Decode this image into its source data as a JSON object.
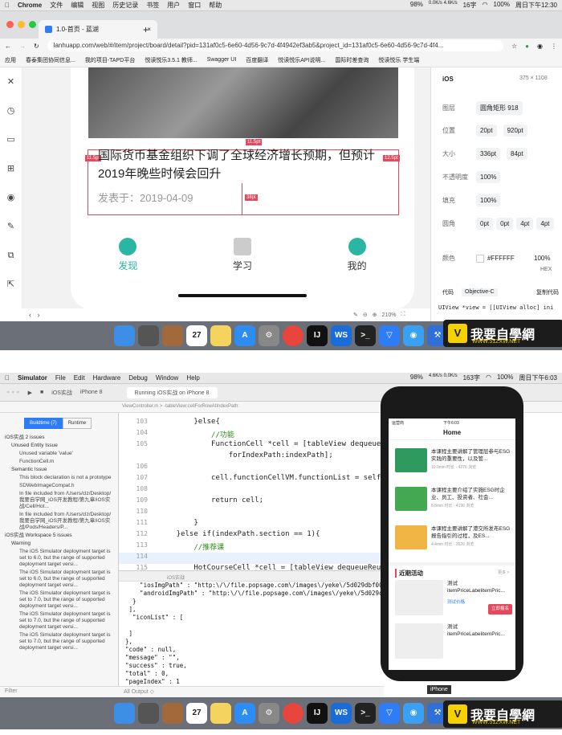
{
  "top": {
    "menubar": {
      "app": "Chrome",
      "menus": [
        "文件",
        "编辑",
        "视图",
        "历史记录",
        "书签",
        "用户",
        "窗口",
        "帮助"
      ],
      "status": [
        "98%",
        "0.0K/s 4.6K/s",
        "16字",
        "100%",
        "周日下午12:30"
      ]
    },
    "tab": {
      "title": "1.0-首页 - 蓝湖",
      "close": "×",
      "new": "+"
    },
    "url": "lanhuapp.com/web/#/item/project/board/detail?pid=131af0c5-6e60-4d56-9c7d-4f4942ef3ab5&project_id=131af0c5-6e60-4d56-9c7d-4f4...",
    "bookmarks": [
      "应用",
      "春泰集团协同信息...",
      "我的项目-TAPD平台",
      "悦读悦乐3.5.1 教师...",
      "Swagger UI",
      "百度翻译",
      "悦读悦乐API说明...",
      "国际时差查询",
      "悦读悦乐 学生端"
    ],
    "design": {
      "headline": "国际货币基金组织下调了全球经济增长预期，但预计2019年晚些时候会回升",
      "date": "发表于：2019-04-09",
      "tags": [
        "11.5pt",
        "11.5pt",
        "12.5pt",
        "38pt"
      ],
      "tabs": [
        "发现",
        "学习",
        "我的"
      ]
    },
    "zoom": "210%",
    "props": {
      "platform": "iOS",
      "size": "375 × 1108",
      "rows": [
        {
          "k": "图层",
          "v": [
            "圆角矩形 918"
          ]
        },
        {
          "k": "位置",
          "v": [
            "20pt",
            "920pt"
          ]
        },
        {
          "k": "大小",
          "v": [
            "336pt",
            "84pt"
          ]
        },
        {
          "k": "不透明度",
          "v": [
            "100%"
          ]
        },
        {
          "k": "填充",
          "v": [
            "100%"
          ]
        },
        {
          "k": "圆角",
          "v": [
            "0pt",
            "0pt",
            "4pt",
            "4pt"
          ]
        }
      ],
      "color_label": "颜色",
      "color_value": "#FFFFFF",
      "color_pct": "100%",
      "hex": "HEX",
      "code_label": "代码",
      "code_lang": "Objective-C",
      "copy": "复制代码",
      "code": "UIView *view = [[UIView alloc] ini"
    }
  },
  "bottom": {
    "menubar": {
      "app": "Simulator",
      "menus": [
        "File",
        "Edit",
        "Hardware",
        "Debug",
        "Window",
        "Help"
      ],
      "status": [
        "98%",
        "4.6K/s 0.0K/s",
        "163字",
        "100%",
        "周日下午6:03"
      ]
    },
    "toolbar": {
      "scheme": "iOS实战",
      "device": "iPhone 8",
      "status": "Running iOS实战 on iPhone 8"
    },
    "crumb": "ViewController.m  >  -tableView:cellForRowAtIndexPath:",
    "nav": {
      "seg": [
        "Buildtime (7)",
        "Runtime"
      ],
      "items": [
        {
          "cls": "it",
          "t": "iOS实战 2 issues"
        },
        {
          "cls": "it2",
          "t": "Unused Entity Issue"
        },
        {
          "cls": "it3",
          "t": "Unused variable 'value'"
        },
        {
          "cls": "it3",
          "t": "FunctionCell.m"
        },
        {
          "cls": "it2",
          "t": "Semantic Issue"
        },
        {
          "cls": "it3",
          "t": "This block declaration is not a prototype"
        },
        {
          "cls": "it3",
          "t": "SDWebImageCompat.h"
        },
        {
          "cls": "it3",
          "t": "In file included from /Users/clz/Desktop/我要自学网_iOS开发教程/第九章/iOS实战/Cell/Hot..."
        },
        {
          "cls": "it3",
          "t": "In file included from /Users/clz/Desktop/我要自学网_iOS开发教程/第九章/iOS实战/Pods/Headers/P..."
        },
        {
          "cls": "it",
          "t": "iOS实战 Workspace 5 issues"
        },
        {
          "cls": "it2",
          "t": "Warning"
        },
        {
          "cls": "it3",
          "t": "The iOS Simulator deployment target is set to 6.0, but the range of supported deployment target versi..."
        },
        {
          "cls": "it3",
          "t": "The iOS Simulator deployment target is set to 6.0, but the range of supported deployment target versi..."
        },
        {
          "cls": "it3",
          "t": "The iOS Simulator deployment target is set to 7.0, but the range of supported deployment target versi..."
        },
        {
          "cls": "it3",
          "t": "The iOS Simulator deployment target is set to 7.0, but the range of supported deployment target versi..."
        },
        {
          "cls": "it3",
          "t": "The iOS Simulator deployment target is set to 7.0, but the range of supported deployment target versi..."
        }
      ],
      "filter": "Filter"
    },
    "code_lines": [
      {
        "n": "103",
        "html": "        }else{"
      },
      {
        "n": "104",
        "html": "            //功能"
      },
      {
        "n": "105",
        "html": "            FunctionCell *cell = [tableView dequeueReusab"
      },
      {
        "n": "",
        "html": "                forIndexPath:indexPath];"
      },
      {
        "n": "106",
        "html": ""
      },
      {
        "n": "107",
        "html": "            cell.functionCellVM.functionList = self.viewC"
      },
      {
        "n": "108",
        "html": ""
      },
      {
        "n": "109",
        "html": "            return cell;"
      },
      {
        "n": "110",
        "html": ""
      },
      {
        "n": "111",
        "html": "        }"
      },
      {
        "n": "112",
        "html": "    }else if(indexPath.section == 1){"
      },
      {
        "n": "113",
        "html": "        //推荐课"
      },
      {
        "n": "114",
        "html": ""
      },
      {
        "n": "115",
        "html": "        HotCourseCell *cell = [tableView dequeueReusableCe"
      },
      {
        "n": "",
        "html": "            forIndexPath:indexPath];"
      },
      {
        "n": "116",
        "html": ""
      },
      {
        "n": "117",
        "html": "        [cell.hotCourseCellVM setModel:self.viewControlle"
      }
    ],
    "debug_crumb": "iOS实战",
    "console": "    \"iosImgPath\" : \"http:\\/\\/file.popsage.com\\/images\\/yeke\\/5d029dbf0081c43\n    \"androidImgPath\" : \"http:\\/\\/file.popsage.com\\/images\\/yeke\\/5d029dbf00\n  }\n ],\n  \"iconList\" : [\n\n ]\n},\n\"code\" : null,\n\"message\" : \"\",\n\"success\" : true,\n\"total\" : 0,\n\"pageIndex\" : 1",
    "console_footer": "All Output ◇",
    "sim": {
      "carrier": "运营商",
      "time": "下午6:03",
      "title": "Home",
      "courses": [
        {
          "t": "本课程主要讲解了管理层参与ESG实践的重要性，以及管...",
          "m": "10.0min 时长 · 4276 浏览",
          "c": "#2f9a5e"
        },
        {
          "t": "本课程主要介绍了实施ESG时企业、员工、投资者、社会...",
          "m": "8.8min 时长 · 4196 浏览",
          "c": "#44a852"
        },
        {
          "t": "本课程主要讲解了港交所发布ESG报告指引的过程，及ES...",
          "m": "4.4min 时长 · 3926 浏览",
          "c": "#f0b545"
        }
      ],
      "section": "近期活动",
      "more": "更多 >",
      "events": [
        {
          "t": "测试",
          "t2": "itemPriceLabelitemPric...",
          "tag": "测试价格",
          "btn": "立即报名"
        },
        {
          "t": "测试",
          "t2": "itemPriceLabelitemPric...",
          "tag": "",
          "btn": ""
        }
      ],
      "label": "iPhone"
    },
    "watermark": {
      "big": "我要自學網",
      "small": "WWW.51ZXW.NET",
      "v": "V"
    }
  },
  "colors": {
    "accent": "#2e7cf6",
    "guide": "#e5485c",
    "teal": "#2bb6a3"
  }
}
